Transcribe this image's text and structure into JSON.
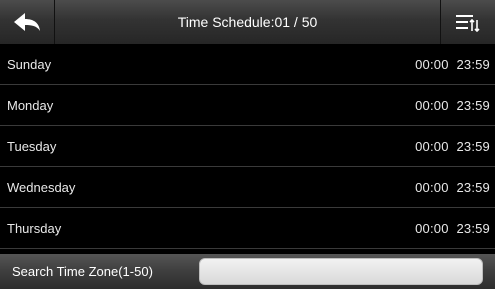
{
  "header": {
    "title": "Time Schedule:01 / 50",
    "back_icon": "back-arrow-icon",
    "menu_icon": "sort-menu-icon"
  },
  "schedule": [
    {
      "day": "Sunday",
      "start": "00:00",
      "end": "23:59"
    },
    {
      "day": "Monday",
      "start": "00:00",
      "end": "23:59"
    },
    {
      "day": "Tuesday",
      "start": "00:00",
      "end": "23:59"
    },
    {
      "day": "Wednesday",
      "start": "00:00",
      "end": "23:59"
    },
    {
      "day": "Thursday",
      "start": "00:00",
      "end": "23:59"
    }
  ],
  "search": {
    "label": "Search Time Zone(1-50)",
    "value": ""
  },
  "colors": {
    "background": "#000000",
    "text": "#ffffff",
    "row_divider": "#3a3a3a"
  }
}
